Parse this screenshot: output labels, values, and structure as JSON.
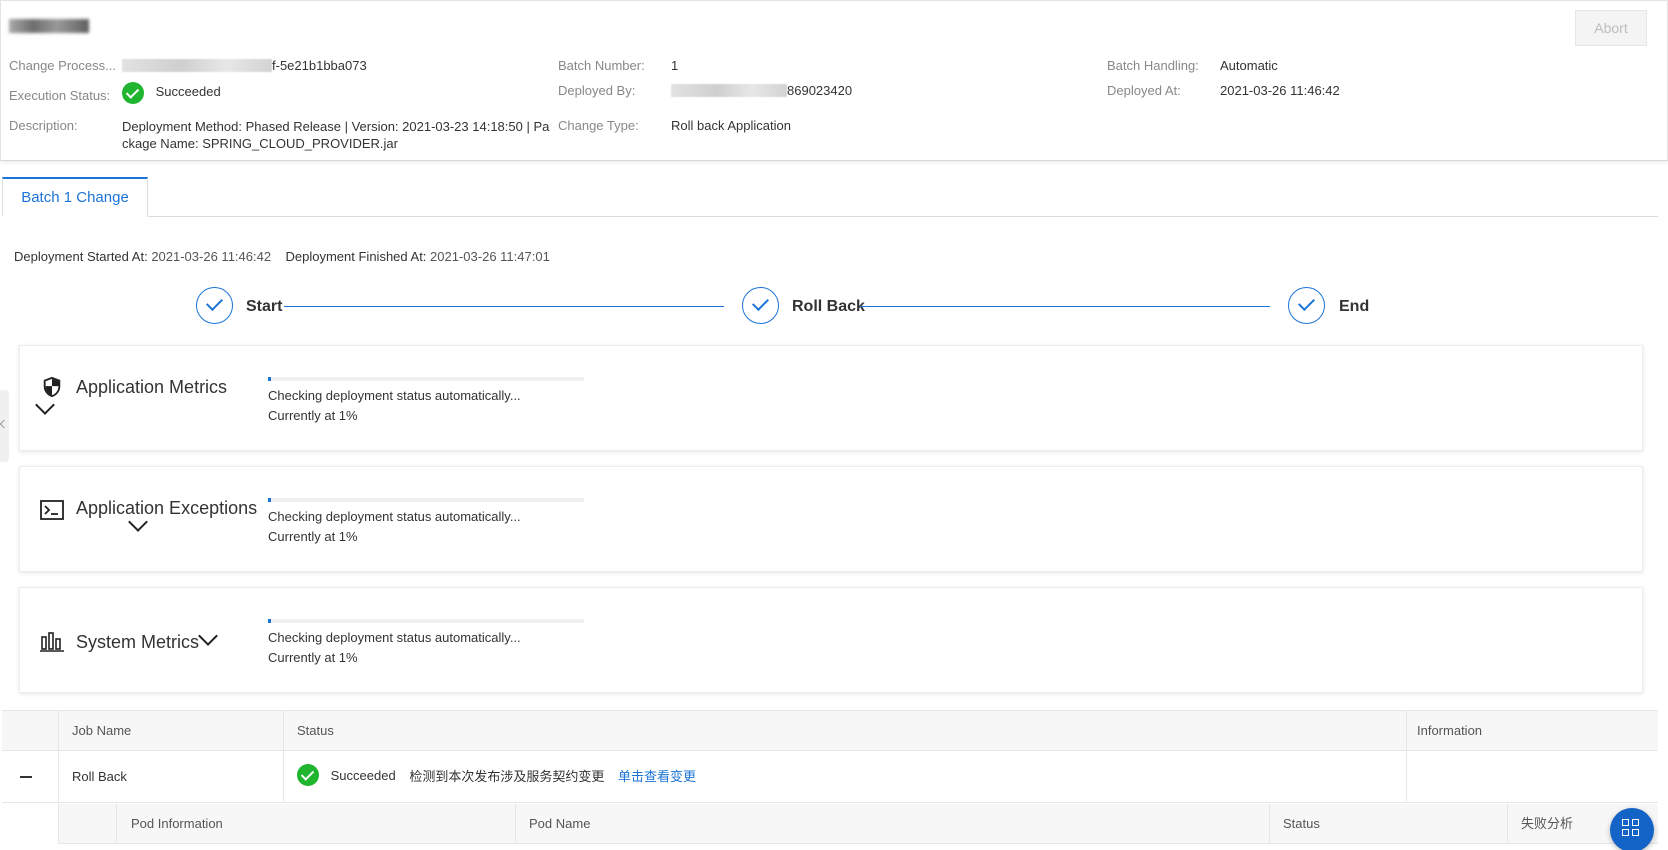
{
  "header": {
    "title": "",
    "abort_label": "Abort",
    "fields": {
      "change_process_label": "Change Process...",
      "change_process_value": "f-5e21b1bba073",
      "execution_status_label": "Execution Status:",
      "execution_status_value": "Succeeded",
      "description_label": "Description:",
      "description_value": "Deployment Method: Phased Release | Version: 2021-03-23 14:18:50 | Package Name: SPRING_CLOUD_PROVIDER.jar",
      "batch_number_label": "Batch Number:",
      "batch_number_value": "1",
      "deployed_by_label": "Deployed By:",
      "deployed_by_value": "869023420",
      "change_type_label": "Change Type:",
      "change_type_value": "Roll back Application",
      "batch_handling_label": "Batch Handling:",
      "batch_handling_value": "Automatic",
      "deployed_at_label": "Deployed At:",
      "deployed_at_value": "2021-03-26 11:46:42"
    }
  },
  "tabs": [
    {
      "label": "Batch 1 Change",
      "active": true
    }
  ],
  "times": {
    "started_label": "Deployment Started At:",
    "started_value": "2021-03-26 11:46:42",
    "finished_label": "Deployment Finished At:",
    "finished_value": "2021-03-26 11:47:01"
  },
  "steps": [
    {
      "label": "Start"
    },
    {
      "label": "Roll Back"
    },
    {
      "label": "End"
    }
  ],
  "cards": [
    {
      "title": "Application Metrics",
      "icon": "shield-icon",
      "status": "Checking deployment status automatically...",
      "progress_text": "Currently at 1%",
      "progress": 0.01
    },
    {
      "title": "Application Exceptions",
      "icon": "terminal-icon",
      "status": "Checking deployment status automatically...",
      "progress_text": "Currently at 1%",
      "progress": 0.01
    },
    {
      "title": "System Metrics",
      "icon": "bar-chart-icon",
      "status": "Checking deployment status automatically...",
      "progress_text": "Currently at 1%",
      "progress": 0.01
    }
  ],
  "table": {
    "headers": [
      "Job Name",
      "Status",
      "Information"
    ],
    "rows": [
      {
        "job_name": "Roll Back",
        "status": "Succeeded",
        "message": "检测到本次发布涉及服务契约变更",
        "link": "单击查看变更",
        "information": ""
      }
    ],
    "sub_headers": [
      "Pod Information",
      "Pod Name",
      "Status",
      "失败分析"
    ]
  },
  "colors": {
    "accent": "#1b74d6",
    "success": "#1fb52f"
  }
}
